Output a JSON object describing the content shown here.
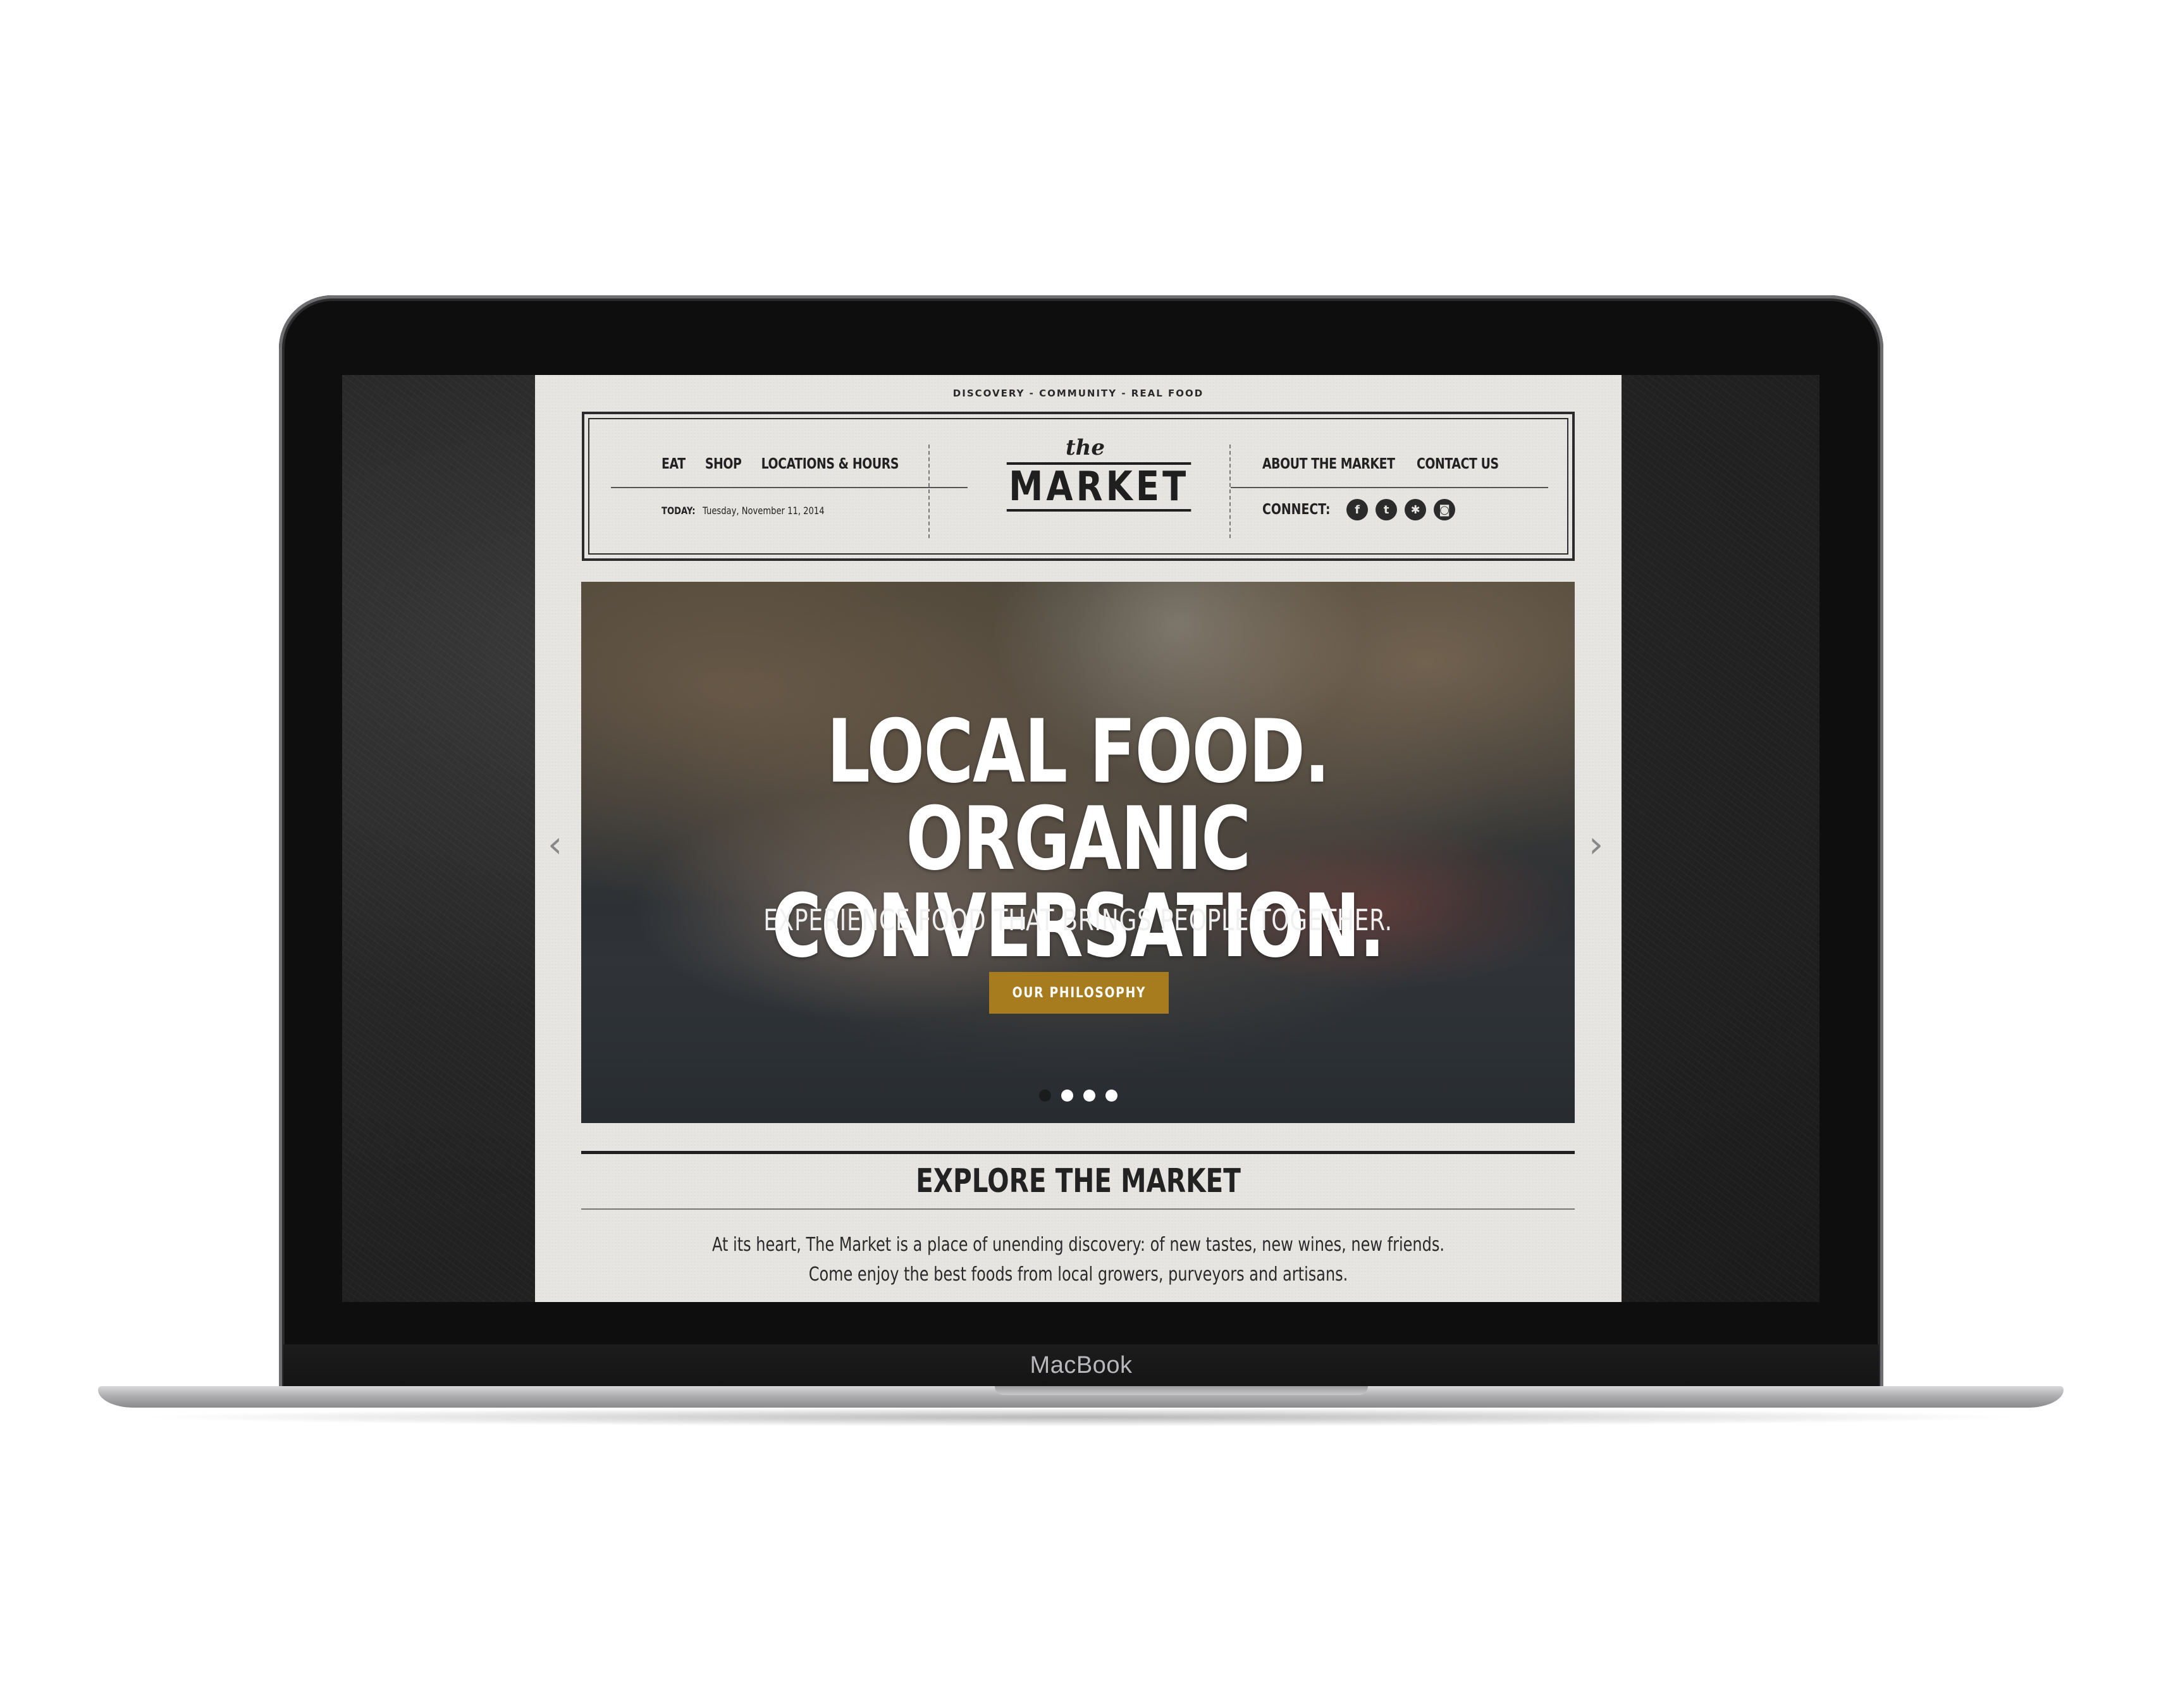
{
  "device": {
    "brand_label": "MacBook"
  },
  "site": {
    "tagline": "DISCOVERY - COMMUNITY - REAL FOOD",
    "logo": {
      "small": "the",
      "main": "MARKET"
    },
    "nav_left": [
      {
        "label": "EAT"
      },
      {
        "label": "SHOP"
      },
      {
        "label": "LOCATIONS & HOURS"
      }
    ],
    "nav_right": [
      {
        "label": "ABOUT THE MARKET"
      },
      {
        "label": "CONTACT US"
      }
    ],
    "today": {
      "label": "TODAY:",
      "date": "Tuesday, November 11, 2014"
    },
    "connect": {
      "label": "CONNECT:",
      "icons": [
        {
          "name": "facebook-icon",
          "glyph": "f"
        },
        {
          "name": "twitter-icon",
          "glyph": "t"
        },
        {
          "name": "yelp-icon",
          "glyph": "✱"
        },
        {
          "name": "instagram-icon",
          "glyph": "◙"
        }
      ]
    },
    "hero": {
      "headline_line1": "LOCAL FOOD. ORGANIC",
      "headline_line2": "CONVERSATION.",
      "subheadline": "EXPERIENCE FOOD THAT BRINGS PEOPLE TOGETHER.",
      "button_label": "OUR PHILOSOPHY",
      "prev_arrow": "‹",
      "next_arrow": "›",
      "slides_total": 4,
      "active_slide": 2
    },
    "explore": {
      "title": "EXPLORE THE MARKET",
      "body_line1": "At its heart, The Market is a place of unending discovery: of new tastes, new wines, new friends.",
      "body_line2": "Come enjoy the best foods from local growers, purveyors and artisans."
    },
    "colors": {
      "accent_button": "#a77c1e",
      "page_background": "#e6e5e1",
      "ink": "#222222"
    }
  }
}
